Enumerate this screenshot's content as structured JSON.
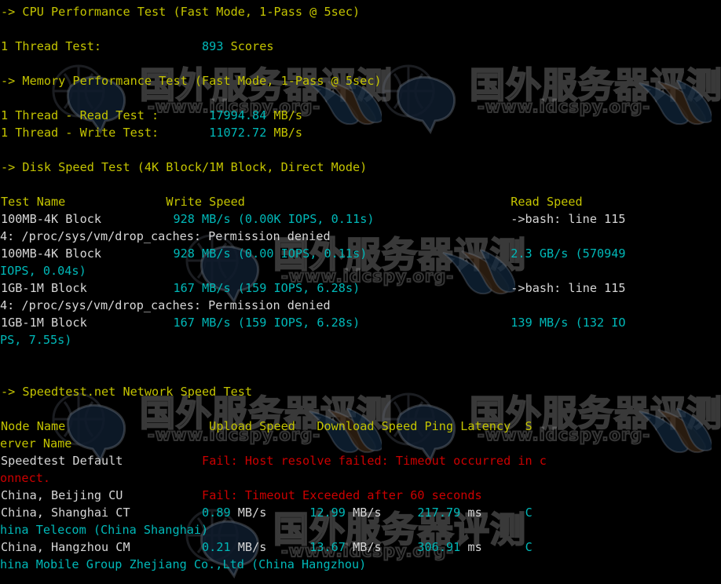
{
  "terminal": {
    "background": "#000000",
    "colors": {
      "yellow": "#c4c400",
      "cyan": "#00b8b8",
      "red": "#cc0000",
      "white": "#d6d6d6"
    },
    "sections": {
      "cpu_header": "-> CPU Performance Test (Fast Mode, 1-Pass @ 5sec)",
      "memory_header": "-> Memory Performance Test (Fast Mode, 1-Pass @ 5sec)",
      "disk_header": "-> Disk Speed Test (4K Block/1M Block, Direct Mode)",
      "speedtest_header": "-> Speedtest.net Network Speed Test"
    },
    "cpu": {
      "label": "1 Thread Test:",
      "value": "893",
      "unit": "Scores"
    },
    "memory": {
      "read_label": "1 Thread - Read Test :",
      "read_value": "17994.84",
      "read_unit": "MB/s",
      "write_label": "1 Thread - Write Test:",
      "write_value": "11072.72",
      "write_unit": "MB/s"
    },
    "disk": {
      "headers": {
        "test_name": "Test Name",
        "write_speed": "Write Speed",
        "read_speed": "Read Speed"
      },
      "rows": [
        {
          "name": "100MB-4K Block",
          "write_value": "928",
          "write_unit": "MB/s",
          "write_detail": "(0.00K IOPS, 0.11s)",
          "read_text": "->bash: line 115"
        },
        {
          "error_line": "4: /proc/sys/vm/drop_caches: Permission denied"
        },
        {
          "name": "100MB-4K Block",
          "write_value": "928",
          "write_unit": "MB/s",
          "write_detail": "(0.00 IOPS, 0.11s)",
          "read_text": "2.3 GB/s (570949"
        },
        {
          "wrap_line": "IOPS, 0.04s)"
        },
        {
          "name": "1GB-1M Block",
          "write_value": "167",
          "write_unit": "MB/s",
          "write_detail": "(159 IOPS, 6.28s)",
          "read_text": "->bash: line 115"
        },
        {
          "error_line": "4: /proc/sys/vm/drop_caches: Permission denied"
        },
        {
          "name": "1GB-1M Block",
          "write_value": "167",
          "write_unit": "MB/s",
          "write_detail": "(159 IOPS, 6.28s)",
          "read_text": "139 MB/s (132 IO"
        },
        {
          "wrap_line": "PS, 7.55s)"
        }
      ]
    },
    "speedtest": {
      "headers": {
        "node_name": "Node Name",
        "upload_speed": "Upload Speed",
        "download_speed": "Download Speed",
        "ping_latency": "Ping Latency",
        "server_col_partial": "S",
        "server_name_wrap": "erver Name"
      },
      "rows": [
        {
          "node": "Speedtest Default",
          "status": "Fail: Host resolve failed: Timeout occurred in c",
          "status_wrap": "onnect.",
          "state": "fail"
        },
        {
          "node": "China, Beijing CU",
          "status": "Fail: Timeout Exceeded after 60 seconds",
          "state": "fail"
        },
        {
          "node": "China, Shanghai CT",
          "upload_value": "0.89",
          "upload_unit": "MB/s",
          "download_value": "12.99",
          "download_unit": "MB/s",
          "ping_value": "217.79",
          "ping_unit": "ms",
          "server_partial": "C",
          "server_wrap": "hina Telecom (China Shanghai)",
          "state": "ok"
        },
        {
          "node": "China, Hangzhou CM",
          "upload_value": "0.21",
          "upload_unit": "MB/s",
          "download_value": "13.67",
          "download_unit": "MB/s",
          "ping_value": "306.91",
          "ping_unit": "ms",
          "server_partial": "C",
          "server_wrap": "hina Mobile Group Zhejiang Co.,Ltd (China Hangzhou)",
          "state": "ok"
        }
      ]
    }
  },
  "watermark": {
    "text_cn": "国外服务器评测",
    "text_url": "-www.idcspy.org-"
  }
}
